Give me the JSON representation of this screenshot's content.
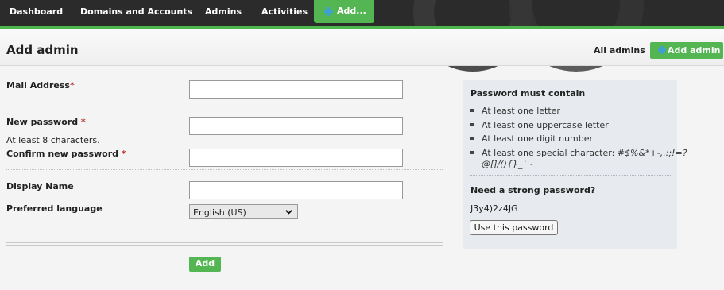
{
  "nav": {
    "items": [
      "Dashboard",
      "Domains and Accounts",
      "Admins",
      "Activities"
    ],
    "add_label": "Add..."
  },
  "header": {
    "title": "Add admin",
    "all_admins": "All admins",
    "add_admin": "Add admin"
  },
  "form": {
    "mail_label": "Mail Address",
    "password_label": "New password",
    "password_hint": "At least 8 characters.",
    "confirm_label": "Confirm new password",
    "required_mark": "*",
    "display_label": "Display Name",
    "language_label": "Preferred language",
    "language_value": "English (US)",
    "submit": "Add"
  },
  "panel": {
    "title": "Password must contain",
    "rules": [
      "At least one letter",
      "At least one uppercase letter",
      "At least one digit number",
      "At least one special character:"
    ],
    "special_chars_line1": "#$%&*+-,.:;!=?",
    "special_chars_line2": "@[]/(){}_`~",
    "strong_title": "Need a strong password?",
    "generated": "J3y4)2z4JG",
    "use_button": "Use this password"
  },
  "colors": {
    "accent": "#53b653",
    "nav_bg": "#2b2b2b",
    "required": "#c23030",
    "panel_bg": "#e7ebef"
  },
  "icons": [
    "plus-icon",
    "chevron-down-icon"
  ]
}
